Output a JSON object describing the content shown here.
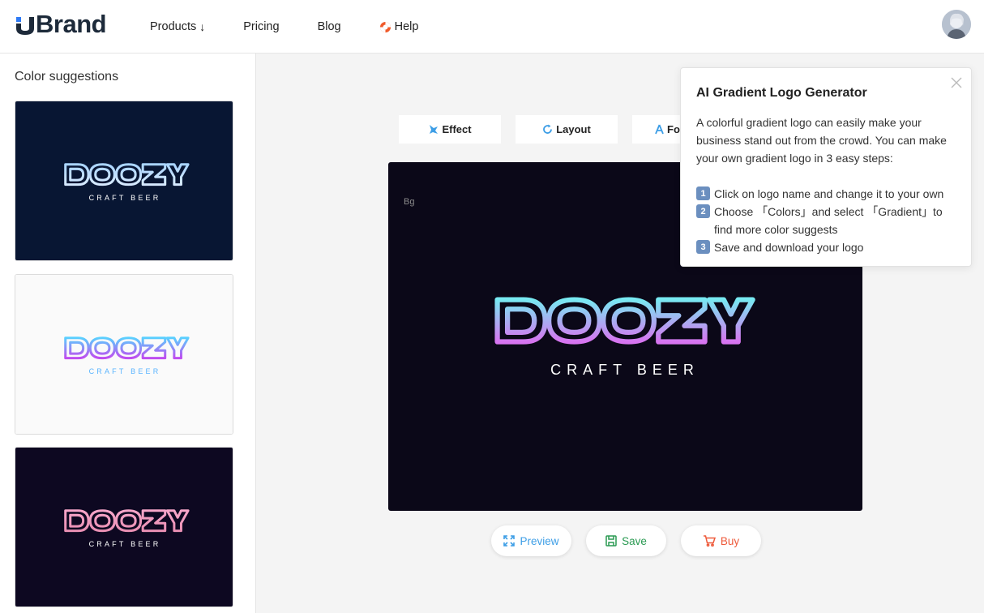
{
  "header": {
    "brand": "Brand",
    "nav": [
      {
        "label": "Products",
        "arrow": "↓"
      },
      {
        "label": "Pricing"
      },
      {
        "label": "Blog"
      },
      {
        "label": "Help"
      }
    ]
  },
  "sidebar": {
    "title": "Color suggestions",
    "cards": [
      {
        "logo": "DOOZY",
        "tagline": "CRAFT BEER",
        "bg": "#081633",
        "stroke_from": "#a9d4ff",
        "stroke_to": "#d6e9ff",
        "tagline_color": "#ffffff"
      },
      {
        "logo": "DOOZY",
        "tagline": "CRAFT BEER",
        "bg": "#fafafa",
        "stroke_from": "#5ad0ff",
        "stroke_to": "#c04cf0",
        "tagline_color": "#5ab4ff"
      },
      {
        "logo": "DOOZY",
        "tagline": "CRAFT BEER",
        "bg": "#0d0821",
        "stroke_from": "#f7a6c9",
        "stroke_to": "#e98fb3",
        "tagline_color": "#ffffff"
      }
    ]
  },
  "toolbar": {
    "effect": "Effect",
    "layout": "Layout",
    "font": "Fo"
  },
  "canvas": {
    "bg_label": "Bg",
    "logo": "DOOZY",
    "tagline": "CRAFT BEER",
    "bg": "#0b0818",
    "gradient_from": "#78e9f2",
    "gradient_to": "#d774f0"
  },
  "actions": {
    "preview": "Preview",
    "save": "Save",
    "buy": "Buy",
    "preview_color": "#3d9ee6",
    "save_color": "#2a9a52",
    "buy_color": "#ee5a3b"
  },
  "popup": {
    "title": "AI Gradient Logo Generator",
    "body": "A colorful gradient logo can easily make your business stand out from the crowd. You can make your own gradient logo in 3 easy steps:",
    "steps": [
      {
        "num": "1",
        "text": "Click on logo name and change it to your own"
      },
      {
        "num": "2",
        "text": "Choose 「Colors」and select 「Gradient」to find more color suggests"
      },
      {
        "num": "3",
        "text": "Save and download your logo"
      }
    ]
  }
}
